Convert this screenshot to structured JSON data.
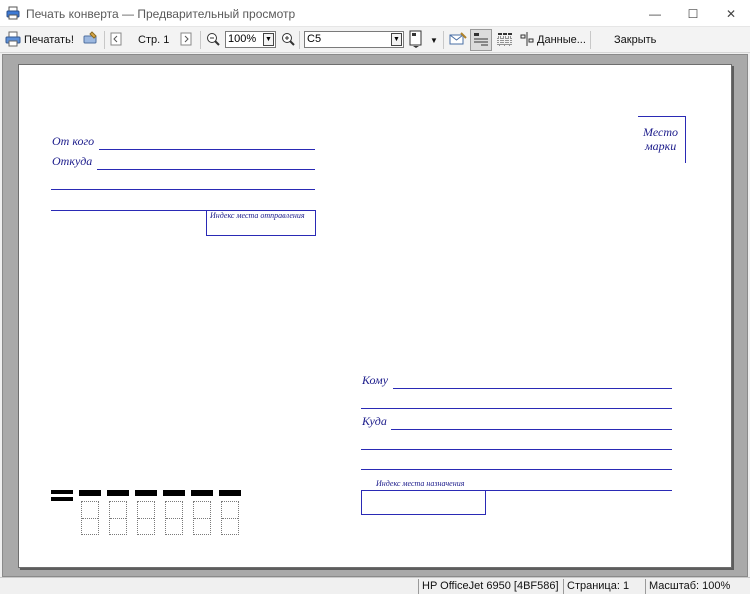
{
  "window": {
    "title": "Печать конверта — Предварительный просмотр",
    "minimize_glyph": "—",
    "maximize_glyph": "☐",
    "close_glyph": "✕"
  },
  "toolbar": {
    "print_label": "Печатать!",
    "page_label": "Стр. 1",
    "zoom_value": "100%",
    "format_value": "C5",
    "data_label": "Данные...",
    "close_label": "Закрыть"
  },
  "envelope": {
    "from_label": "От кого",
    "from_where_label": "Откуда",
    "sender_index_label": "Индекс места отправления",
    "stamp_label_line1": "Место",
    "stamp_label_line2": "марки",
    "to_label": "Кому",
    "to_where_label": "Куда",
    "recipient_index_label": "Индекс места назначения",
    "ink_color": "#2a2ab5"
  },
  "statusbar": {
    "printer": "HP OfficeJet 6950 [4BF586]",
    "page": "Страница: 1",
    "zoom": "Масштаб: 100%"
  }
}
